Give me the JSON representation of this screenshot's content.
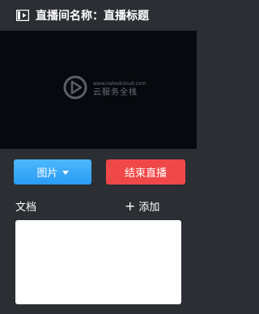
{
  "header": {
    "title": "直播间名称：直播标题",
    "icon": "video-player-icon"
  },
  "video": {
    "watermark_line1": "www.nakedcloud.com",
    "watermark_line2": "云服务全栈"
  },
  "controls": {
    "image_label": "图片",
    "end_label": "结束直播"
  },
  "document": {
    "label": "文档",
    "add_label": "添加"
  },
  "colors": {
    "background": "#2b2e33",
    "video_bg": "#06090d",
    "image_button": "#2a9bf2",
    "end_button": "#f04848"
  }
}
